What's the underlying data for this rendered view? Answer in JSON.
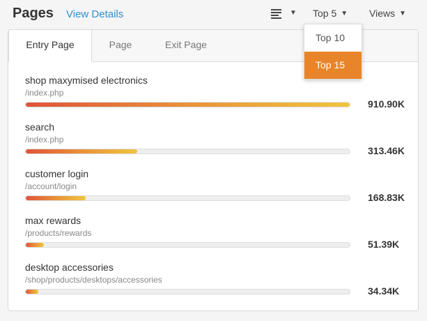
{
  "header": {
    "title": "Pages",
    "view_details": "View Details",
    "top_select": "Top 5",
    "metric_select": "Views",
    "list_icon": "list-icon"
  },
  "tabs": [
    {
      "label": "Entry Page",
      "active": true
    },
    {
      "label": "Page",
      "active": false
    },
    {
      "label": "Exit Page",
      "active": false
    }
  ],
  "rows": [
    {
      "name": "shop maxymised electronics",
      "path": "/index.php",
      "value": "910.90K",
      "fraction": 1.0
    },
    {
      "name": "search",
      "path": "/index.php",
      "value": "313.46K",
      "fraction": 0.344
    },
    {
      "name": "customer login",
      "path": "/account/login",
      "value": "168.83K",
      "fraction": 0.185
    },
    {
      "name": "max rewards",
      "path": "/products/rewards",
      "value": "51.39K",
      "fraction": 0.056
    },
    {
      "name": "desktop accessories",
      "path": "/shop/products/desktops/accessories",
      "value": "34.34K",
      "fraction": 0.038
    }
  ],
  "dropdown": {
    "items": [
      {
        "label": "Top 10",
        "selected": false
      },
      {
        "label": "Top 15",
        "selected": true
      }
    ]
  },
  "colors": {
    "accent": "#e8852a",
    "link": "#2b8fd1",
    "bar_start": "#e0533a",
    "bar_end": "#f0c53e"
  }
}
